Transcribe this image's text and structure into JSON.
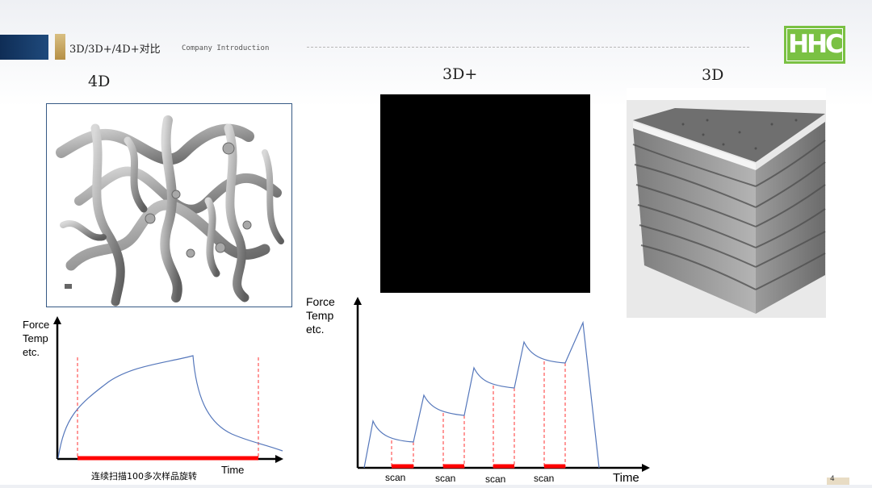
{
  "header": {
    "title": "3D/3D+/4D+对比",
    "subtitle": "Company Introduction"
  },
  "logo": {
    "text": "HHC",
    "color": "#7ac143"
  },
  "columns": {
    "label_4d": "4D",
    "label_3dplus": "3D+",
    "label_3d": "3D"
  },
  "chart_left": {
    "ylabel": [
      "Force",
      "Temp",
      "etc."
    ],
    "xlabel": "Time",
    "caption": "连续扫描100多次样品旋转"
  },
  "chart_right": {
    "ylabel": [
      "Force",
      "Temp",
      "etc."
    ],
    "xlabel": "Time",
    "scan_labels": [
      "scan",
      "scan",
      "scan",
      "scan"
    ]
  },
  "page_marker": "4",
  "colors": {
    "curve": "#5577bb",
    "scan_marker": "#ff0000",
    "dashed": "#ff3333",
    "frame": "#375a85"
  }
}
